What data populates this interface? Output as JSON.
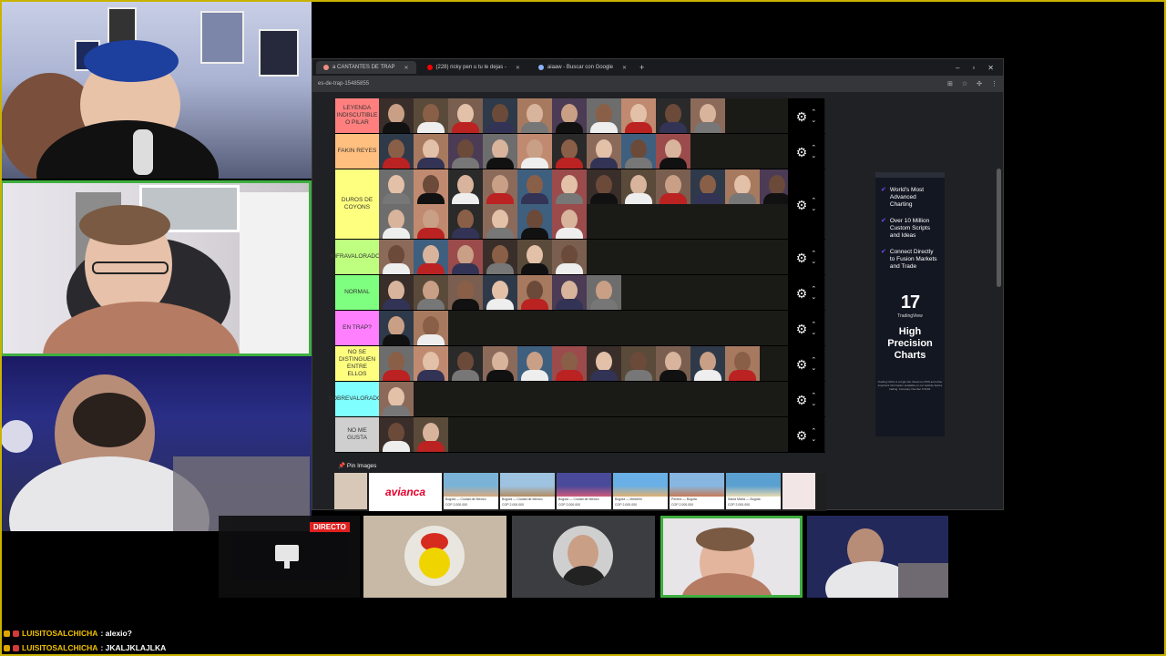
{
  "browser": {
    "tabs": [
      {
        "label": "a CANTANTES DE TRAP",
        "icon_color": "#f28b82",
        "active": true
      },
      {
        "label": "(228) ricky pen u tu le dejas - ",
        "icon_color": "#ff0000",
        "active": false
      },
      {
        "label": "aiaaw - Buscar con Google",
        "icon_color": "#8ab4f8",
        "active": false
      }
    ],
    "new_tab": "+",
    "window_controls": [
      "–",
      "▫",
      "✕"
    ],
    "url": "es-de-trap-15485855"
  },
  "tiers": [
    {
      "label": "LEYENDA INDISCUTIBLE O PILAR",
      "color": "#ff7f7f",
      "count": 10
    },
    {
      "label": "FAKIN REYES",
      "color": "#ffbf7f",
      "count": 9
    },
    {
      "label": "DUROS DE COYONS",
      "color": "#ffff7f",
      "count": 18
    },
    {
      "label": "INFRAVALORADOS",
      "color": "#bfff7f",
      "count": 6
    },
    {
      "label": "NORMAL",
      "color": "#7fff7f",
      "count": 7
    },
    {
      "label": "EN TRAP?",
      "color": "#ff7fff",
      "count": 2
    },
    {
      "label": "NO SE DISTINGUEN ENTRE ELLOS",
      "color": "#ffff7f",
      "count": 11
    },
    {
      "label": "SOBREVALORADOS",
      "color": "#7fffff",
      "count": 1
    },
    {
      "label": "NO ME GUSTA",
      "color": "#cfcfcf",
      "count": 2
    }
  ],
  "ad": {
    "items": [
      "World's Most Advanced Charting",
      "Over 10 Million Custom Scripts and Ideas",
      "Connect Directly to Fusion Markets and Trade"
    ],
    "logo": "17",
    "brand": "TradingView",
    "title": "High Precision Charts",
    "fine_print": "Trading CFDs is a high-risk. Read our PDS and other important information available on our website before trading. Company Number 6 5234."
  },
  "pins": {
    "label": "Pin Images",
    "brand": "avianca",
    "cards": [
      {
        "city": "Bogotá — Ciudad de Mexico",
        "price": "COP 2.000.000",
        "color1": "#7bb3d8",
        "color2": "#d7a97c"
      },
      {
        "city": "Bogotá — Ciudad de Mexico",
        "price": "COP 2.000.000",
        "color1": "#9dc3e0",
        "color2": "#b58c5e"
      },
      {
        "city": "Bogotá — Ciudad de Mexico",
        "price": "COP 2.000.000",
        "color1": "#4a4a9a",
        "color2": "#d05a7a"
      },
      {
        "city": "Bogotá — Medellín",
        "price": "COP 2.000.000",
        "color1": "#6ab0e6",
        "color2": "#e0b070"
      },
      {
        "city": "Pereira — Bogotá",
        "price": "COP 2.000.000",
        "color1": "#87b6e0",
        "color2": "#c77c55"
      },
      {
        "city": "Santa Marta — Bogotá",
        "price": "COP 2.000.000",
        "color1": "#5aa0d0",
        "color2": "#e8d9b0"
      }
    ]
  },
  "stream": {
    "live_badge": "DIRECTO"
  },
  "chat": [
    {
      "user": "LUISITOSALCHICHA",
      "message": ": alexio?"
    },
    {
      "user": "LUISITOSALCHICHA",
      "message": ": JKALJKLAJLKA"
    }
  ]
}
